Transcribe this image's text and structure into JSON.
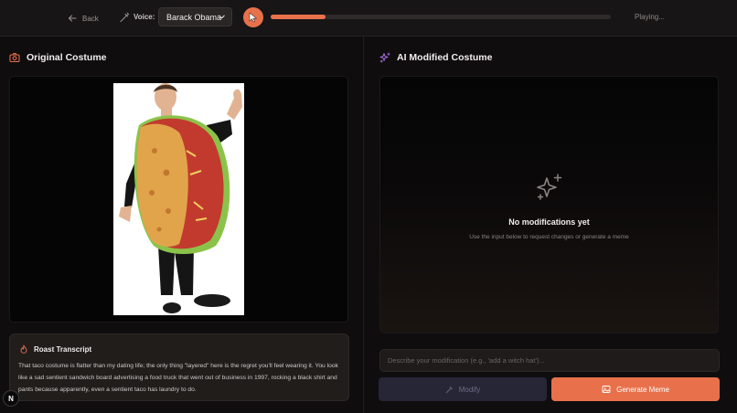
{
  "header": {
    "back_label": "Back",
    "voice_label": "Voice:",
    "voice_selected": "Barack Obama",
    "status": "Playing...",
    "progress": 0.16
  },
  "original": {
    "title": "Original Costume"
  },
  "modified": {
    "title": "AI Modified Costume",
    "empty_title": "No modifications yet",
    "empty_subtitle": "Use the input below to request changes or generate a meme"
  },
  "transcript": {
    "title": "Roast Transcript",
    "text": "That taco costume is flatter than my dating life; the only thing \"layered\" here is the regret you'll feel wearing it. You look like a sad sentient sandwich board advertising a food truck that went out of business in 1997, rocking a black shirt and pants because apparently, even a sentient taco has laundry to do."
  },
  "controls": {
    "input_placeholder": "Describe your modification (e.g., 'add a witch hat')...",
    "modify_label": "Modify",
    "generate_label": "Generate Meme"
  },
  "badge": {
    "letter": "N"
  },
  "colors": {
    "accent": "#e8714c",
    "background": "#0f0d0e",
    "purple": "#a56be0"
  },
  "icons": [
    "arrow-left-icon",
    "wand-icon",
    "chevron-down-icon",
    "cursor-icon",
    "camera-icon",
    "sparkles-icon",
    "flame-icon",
    "image-icon"
  ]
}
